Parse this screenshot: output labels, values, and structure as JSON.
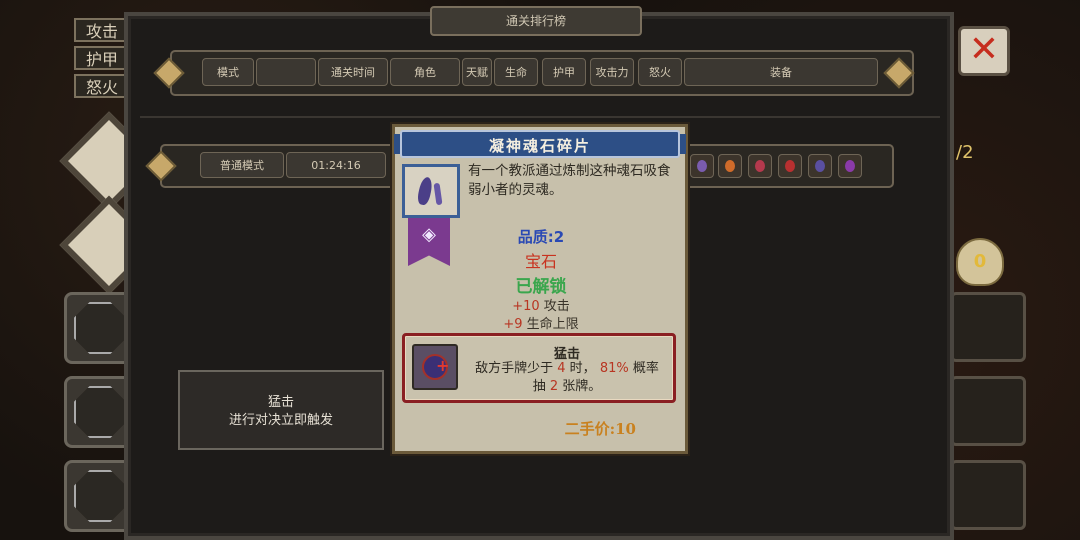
{
  "window": {
    "title": "通关排行榜"
  },
  "left_tabs": [
    "攻击",
    "护甲",
    "怒火"
  ],
  "header_columns": [
    "模式",
    "",
    "通关时间",
    "角色",
    "天赋",
    "生命",
    "护甲",
    "攻击力",
    "怒火",
    "装备"
  ],
  "row": {
    "mode": "普通模式",
    "time": "01:24:16"
  },
  "right_counter": "/2",
  "bag_count": "0",
  "close_icon": "close-x-icon",
  "left_tooltip": {
    "title": "猛击",
    "text": "进行对决立即触发"
  },
  "card": {
    "name": "凝神魂石碎片",
    "description": "有一个教派通过炼制这种魂石吸食弱小者的灵魂。",
    "quality": "品质:2",
    "category": "宝石",
    "status": "已解锁",
    "stats": [
      {
        "num": "+10",
        "label": "攻击"
      },
      {
        "num": "+9",
        "label": "生命上限"
      }
    ],
    "skill": {
      "name": "猛击",
      "text_a": "敌方手牌少于",
      "val1": "4",
      "text_b": "时，",
      "val2": "81%",
      "text_c": "概率",
      "text_d": "抽",
      "val3": "2",
      "text_e": "张牌。"
    },
    "price": "二手价:10"
  },
  "colors": {
    "banner": "#2d4f86",
    "quality": "#2a49b4",
    "category": "#c8321f",
    "unlocked": "#3aa64d",
    "price": "#c9811f",
    "skill_border": "#8a1f22"
  }
}
